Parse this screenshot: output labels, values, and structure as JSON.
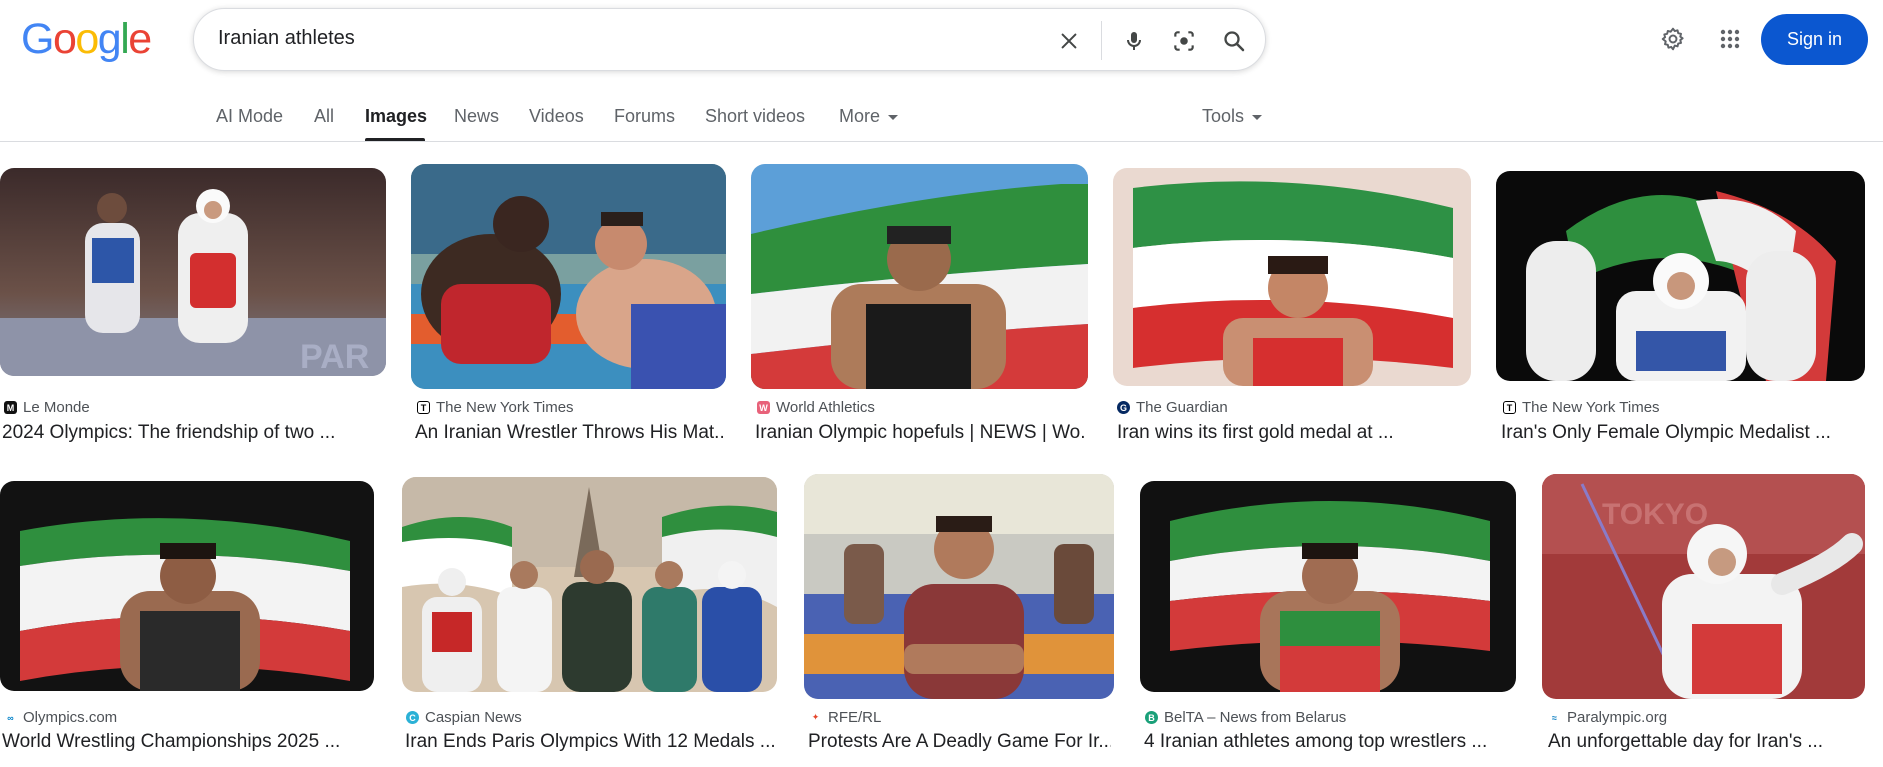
{
  "logo": {
    "letters": [
      "G",
      "o",
      "o",
      "g",
      "l",
      "e"
    ]
  },
  "search": {
    "query": "Iranian athletes"
  },
  "header": {
    "signin_label": "Sign in"
  },
  "tabs": [
    {
      "label": "AI Mode"
    },
    {
      "label": "All"
    },
    {
      "label": "Images"
    },
    {
      "label": "News"
    },
    {
      "label": "Videos"
    },
    {
      "label": "Forums"
    },
    {
      "label": "Short videos"
    },
    {
      "label": "More"
    }
  ],
  "tools_label": "Tools",
  "results": [
    {
      "source": "Le Monde",
      "title": "2024 Olympics: The friendship of two ..."
    },
    {
      "source": "The New York Times",
      "title": "An Iranian Wrestler Throws His Mat..."
    },
    {
      "source": "World Athletics",
      "title": "Iranian Olympic hopefuls | NEWS | Wo..."
    },
    {
      "source": "The Guardian",
      "title": "Iran wins its first gold medal at ..."
    },
    {
      "source": "The New York Times",
      "title": "Iran's Only Female Olympic Medalist ..."
    },
    {
      "source": "Olympics.com",
      "title": "World Wrestling Championships 2025 ..."
    },
    {
      "source": "Caspian News",
      "title": "Iran Ends Paris Olympics With 12 Medals ..."
    },
    {
      "source": "RFE/RL",
      "title": "Protests Are A Deadly Game For Ir..."
    },
    {
      "source": "BelTA – News from Belarus",
      "title": "4 Iranian athletes among top wrestlers ..."
    },
    {
      "source": "Paralympic.org",
      "title": "An unforgettable day for Iran's ..."
    }
  ],
  "colors": {
    "signin_bg": "#0b57d0",
    "link_text": "#202124",
    "muted": "#5f6368"
  }
}
